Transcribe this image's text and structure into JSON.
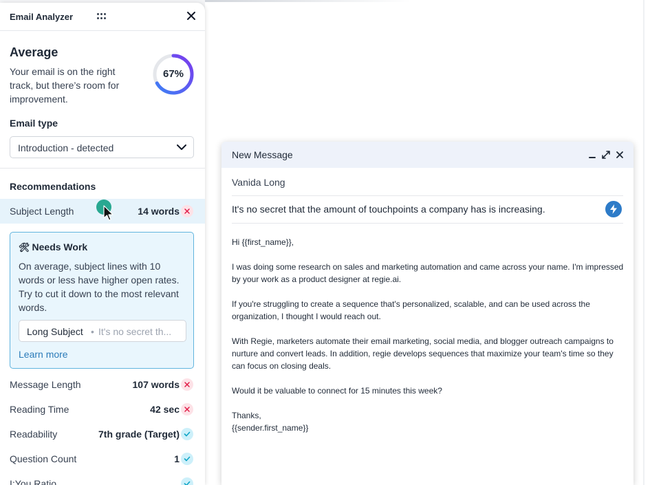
{
  "panel": {
    "title": "Email Analyzer",
    "close_icon": "close-icon",
    "drag_icon": "drag-handle-icon"
  },
  "score": {
    "title": "Average",
    "description": "Your email is on the right track, but there’s room for improvement.",
    "percent_label": "67%",
    "percent": 67,
    "gauge_color_start": "#3b82f6",
    "gauge_color_end": "#7c3aed",
    "gauge_track_color": "#e5e7eb"
  },
  "email_type": {
    "label": "Email type",
    "selected": "Introduction - detected"
  },
  "recommendations": {
    "title": "Recommendations",
    "subject_length": {
      "name": "Subject Length",
      "value": "14 words",
      "status": "bad"
    },
    "card": {
      "title": "Needs Work",
      "icon": "tools-icon",
      "body": "On average, subject lines with 10 words or less have higher open rates. Try to cut it down to the most relevant words.",
      "chip_label": "Long Subject",
      "chip_separator": "•",
      "chip_preview": "It's no secret th...",
      "link": "Learn more"
    },
    "metrics": [
      {
        "name": "Message Length",
        "value": "107 words",
        "status": "bad"
      },
      {
        "name": "Reading Time",
        "value": "42 sec",
        "status": "bad"
      },
      {
        "name": "Readability",
        "value": "7th grade (Target)",
        "status": "good"
      },
      {
        "name": "Question Count",
        "value": "1",
        "status": "good"
      },
      {
        "name": "I:You Ratio",
        "value": "",
        "status": "good"
      }
    ]
  },
  "compose": {
    "title": "New Message",
    "recipient": "Vanida Long",
    "subject": "It's no secret that the amount of touchpoints a company has is increasing.",
    "body": {
      "greeting": "Hi {{first_name}},",
      "p1": "I was doing some research on sales and marketing automation and came across your name. I'm impressed by your work as a product designer at regie.ai.",
      "p2": "If you're struggling to create a sequence that's personalized, scalable, and can be used across the organization, I thought I would reach out.",
      "p3": "With Regie, marketers automate their email marketing, social media, and blogger outreach campaigns to nurture and convert leads. In addition, regie develops sequences that maximize your team's time so they can focus on closing deals.",
      "p4": "Would it be valuable to connect for 15 minutes this week?",
      "signoff": "Thanks,",
      "signature": "{{sender.first_name}}"
    }
  },
  "colors": {
    "accent_blue": "#2d7bc8",
    "bad_status": "#e11d48",
    "good_status": "#0ea5c6",
    "cursor_dot": "#14a085"
  }
}
